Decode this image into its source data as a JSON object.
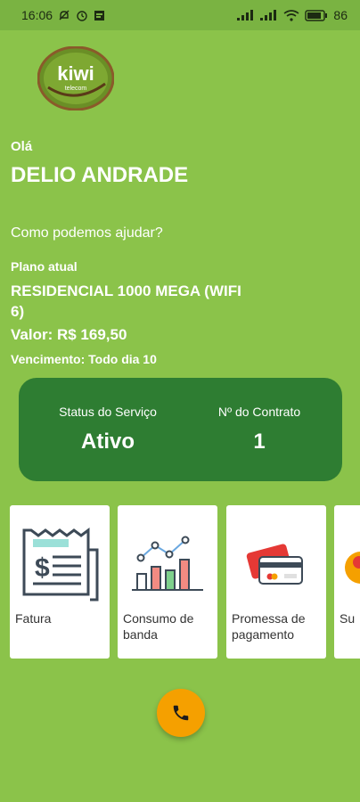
{
  "status_bar": {
    "time": "16:06",
    "battery": "86"
  },
  "logo": {
    "word": "kiwi",
    "sub": "telecom"
  },
  "greeting": {
    "hello": "Olá",
    "name": "DELIO ANDRADE",
    "help": "Como podemos ajudar?"
  },
  "plan": {
    "label": "Plano atual",
    "name": "RESIDENCIAL 1000 MEGA (WIFI 6)",
    "value": "Valor: R$ 169,50",
    "due": "Vencimento: Todo dia 10"
  },
  "service_card": {
    "status_label": "Status do Serviço",
    "status_value": "Ativo",
    "contract_label": "Nº do Contrato",
    "contract_value": "1"
  },
  "tiles": [
    {
      "label": "Fatura",
      "icon": "invoice-icon"
    },
    {
      "label": "Consumo de banda",
      "icon": "bandwidth-chart-icon"
    },
    {
      "label": "Promessa de pagamento",
      "icon": "credit-card-icon"
    },
    {
      "label": "Su",
      "icon": "support-icon"
    }
  ],
  "fab": {
    "icon": "phone-icon"
  },
  "colors": {
    "background": "#8bc34a",
    "card": "#2e7d32",
    "fab": "#f5a000"
  }
}
